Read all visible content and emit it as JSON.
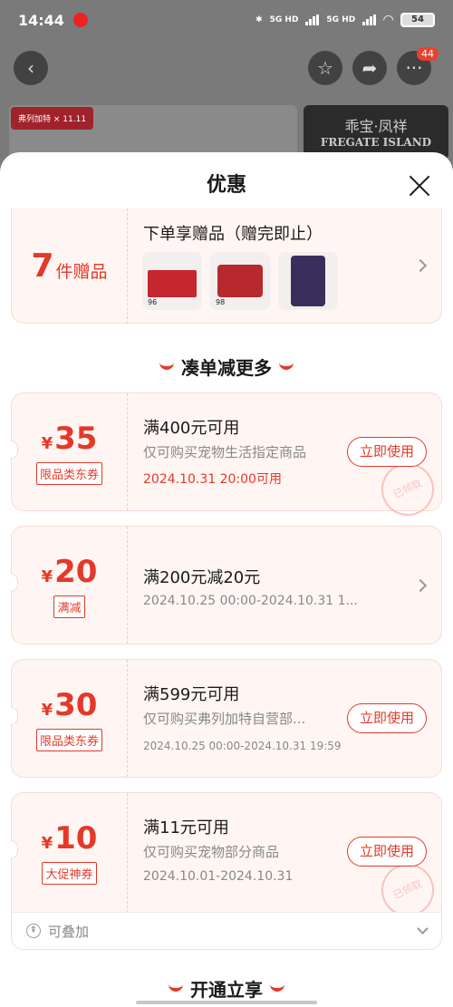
{
  "status_bar": {
    "time": "14:44",
    "network1": "5G HD",
    "network2": "5G HD",
    "battery": "54"
  },
  "background": {
    "more_badge": "44",
    "banner_left_logo": "弗列加特",
    "banner_left_event": "11.11",
    "banner_right_line1": "乖宝·凤祥",
    "banner_right_line2": "FREGATE ISLAND"
  },
  "sheet": {
    "title": "优惠",
    "gift": {
      "count": "7",
      "unit": "件赠品",
      "title": "下单享赠品（赠完即止）",
      "items": [
        {
          "label": "96"
        },
        {
          "label": "98"
        },
        {
          "label": ""
        }
      ]
    },
    "section1": "凑单减更多",
    "coupons": [
      {
        "yen": "¥",
        "amount": "35",
        "tag": "限品类东券",
        "title": "满400元可用",
        "desc": "仅可购买宠物生活指定商品",
        "date": "2024.10.31 20:00可用",
        "button": "立即使用",
        "stamp": "已领取"
      },
      {
        "yen": "¥",
        "amount": "20",
        "tag": "满减",
        "title": "满200元减20元",
        "date": "2024.10.25 00:00-2024.10.31 1..."
      },
      {
        "yen": "¥",
        "amount": "30",
        "tag": "限品类东券",
        "title": "满599元可用",
        "desc": "仅可购买弗列加特自营部...",
        "date": "2024.10.25 00:00-2024.10.31 19:59",
        "button": "立即使用"
      },
      {
        "yen": "¥",
        "amount": "10",
        "tag": "大促神券",
        "title": "满11元可用",
        "desc": "仅可购买宠物部分商品",
        "date": "2024.10.01-2024.10.31",
        "button": "立即使用",
        "stamp": "已领取"
      }
    ],
    "stackable": "可叠加",
    "section2": "开通立享"
  }
}
